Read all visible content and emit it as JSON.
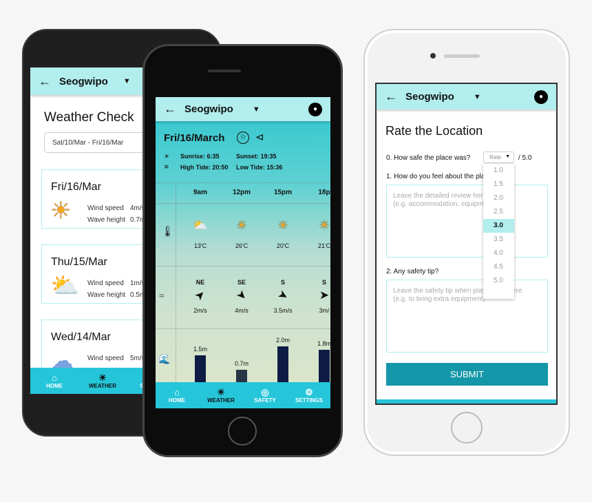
{
  "location": "Seogwipo",
  "nav": [
    {
      "label": "HOME",
      "icon": "home-icon"
    },
    {
      "label": "WEATHER",
      "icon": "weather-icon"
    },
    {
      "label": "SAFETY",
      "icon": "lifebuoy-icon"
    },
    {
      "label": "SETTINGS",
      "icon": "gear-icon"
    }
  ],
  "weather_check": {
    "title": "Weather Check",
    "date_range": "Sat/10/Mar - Fri/16/Mar",
    "days": [
      {
        "date": "Fri/16/Mar",
        "icon": "sun-icon",
        "wind_label": "Wind speed",
        "wind": "4m/s",
        "wave_label": "Wave height",
        "wave": "0.7m"
      },
      {
        "date": "Thu/15/Mar",
        "icon": "cloud-sun-icon",
        "wind_label": "Wind speed",
        "wind": "1m/s",
        "wave_label": "Wave height",
        "wave": "0.5m"
      },
      {
        "date": "Wed/14/Mar",
        "icon": "cloud-icon",
        "wind_label": "Wind speed",
        "wind": "5m/s"
      }
    ]
  },
  "detail": {
    "date": "Fri/16/March",
    "sunrise": "Sunrise: 6:35",
    "sunset": "Sunset: 19:35",
    "high_tide": "High Tide: 20:50",
    "low_tide": "Low Tide: 15:36",
    "hours": [
      {
        "time": "9am",
        "icon": "cloud-sun-icon",
        "temp": "13'C",
        "dir": "NE",
        "rot": 45,
        "wind": "2m/s",
        "wave": 1.5,
        "wave_label": "1.5m"
      },
      {
        "time": "12pm",
        "icon": "sun-icon",
        "temp": "26'C",
        "dir": "SE",
        "rot": 135,
        "wind": "4m/s",
        "wave": 0.7,
        "wave_label": "0.7m"
      },
      {
        "time": "15pm",
        "icon": "sun-icon",
        "temp": "20'C",
        "dir": "S",
        "rot": 120,
        "wind": "3.5m/s",
        "wave": 2.0,
        "wave_label": "2.0m"
      },
      {
        "time": "18p",
        "icon": "sun-icon",
        "temp": "21'C",
        "dir": "S",
        "rot": 90,
        "wind": "3m/",
        "wave": 1.8,
        "wave_label": "1.8m"
      }
    ]
  },
  "rate": {
    "title": "Rate the Location",
    "q0": "0. How safe the place was?",
    "select_placeholder": "Rate",
    "out_of": "/ 5.0",
    "options": [
      "1.0",
      "1.5",
      "2.0",
      "2.5",
      "3.0",
      "3.5",
      "4.0",
      "4.5",
      "5.0"
    ],
    "selected": "3.0",
    "q1": "1. How do you feel about the pla",
    "q1_placeholder": "Leave the detailed review here\n(e.g. accommodation, equipm",
    "q2": "2. Any safety tip?",
    "q2_placeholder": "Leave the safety tip when play          sports here.\n(e.g. to bring extra equipment)",
    "submit": "SUBMIT"
  },
  "colors": {
    "header": "#b2eeee",
    "nav": "#26c6da",
    "submit": "#1497a8",
    "bar": "#0d1b45"
  }
}
